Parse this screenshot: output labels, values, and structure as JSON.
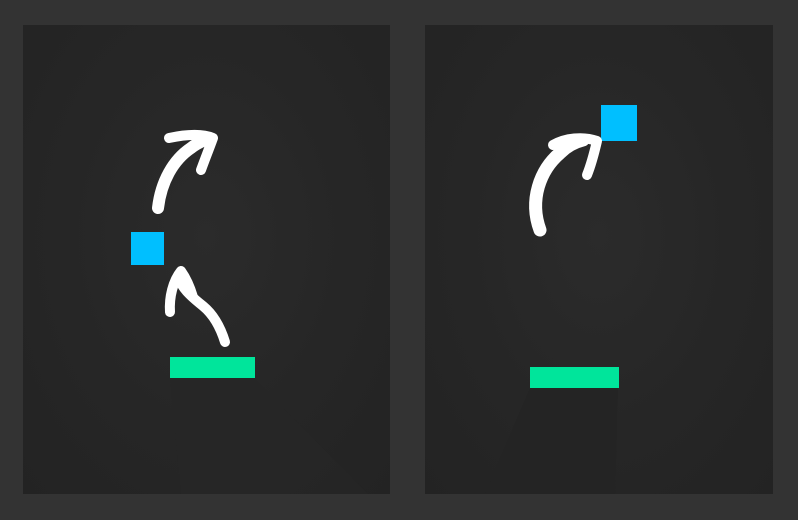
{
  "colors": {
    "background": "#333333",
    "panel": "#262626",
    "player": "#00bfff",
    "platform": "#00e59b",
    "arrow": "#ffffff"
  },
  "panels": [
    {
      "label": "",
      "elements": [
        "player-square",
        "platform",
        "curved-arrow-up",
        "curved-arrow-launch"
      ]
    },
    {
      "label": "",
      "elements": [
        "player-square",
        "platform",
        "curved-arrow-launch"
      ]
    }
  ]
}
